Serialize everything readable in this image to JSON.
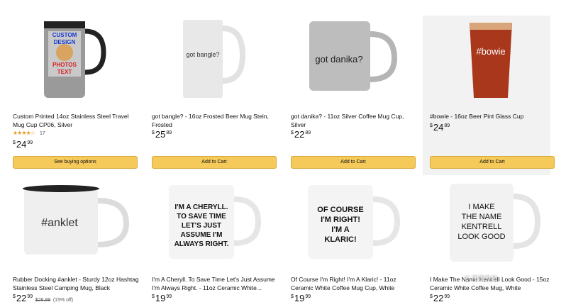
{
  "products": [
    {
      "title": "Custom Printed 14oz Stainless Steel Travel Mug Cup CP06, Silver",
      "price_whole": "24",
      "price_frac": "99",
      "rating_count": "17",
      "button": "See buying options",
      "mug_text": [
        "CUSTOM",
        "DESIGN",
        "PHOTOS",
        "TEXT"
      ]
    },
    {
      "title": "got bangle? - 16oz Frosted Beer Mug Stein, Frosted",
      "price_whole": "25",
      "price_frac": "89",
      "button": "Add to Cart",
      "mug_text": [
        "got bangle?"
      ]
    },
    {
      "title": "got danika? - 11oz Silver Coffee Mug Cup, Silver",
      "price_whole": "22",
      "price_frac": "89",
      "button": "Add to Cart",
      "mug_text": [
        "got danika?"
      ]
    },
    {
      "title": "#bowie - 16oz Beer Pint Glass Cup",
      "price_whole": "24",
      "price_frac": "89",
      "button": "Add to Cart",
      "mug_text": [
        "#bowie"
      ]
    },
    {
      "title": "Rubber Docking #anklet - Sturdy 12oz Hashtag Stainless Steel Camping Mug, Black",
      "price_whole": "22",
      "price_frac": "99",
      "old_price": "$26.99",
      "discount": "(15% off)",
      "mug_text": [
        "#anklet"
      ]
    },
    {
      "title": "I'm A Cheryll. To Save Time Let's Just Assume I'm Always Right. - 11oz Ceramic White...",
      "price_whole": "19",
      "price_frac": "99",
      "mug_text": [
        "I'M A CHERYLL.",
        "TO SAVE TIME",
        "LET'S JUST",
        "ASSUME I'M",
        "ALWAYS RIGHT."
      ]
    },
    {
      "title": "Of Course I'm Right! I'm A Klaric! - 11oz Ceramic White Coffee Mug Cup, White",
      "price_whole": "19",
      "price_frac": "99",
      "mug_text": [
        "OF COURSE",
        "I'M RIGHT!",
        "I'M A",
        "KLARIC!"
      ]
    },
    {
      "title": "I Make The Name Kentrell Look Good - 15oz Ceramic White Coffee Mug, White",
      "price_whole": "22",
      "price_frac": "99",
      "mug_text": [
        "I MAKE",
        "THE NAME",
        "KENTRELL",
        "LOOK GOOD"
      ]
    }
  ],
  "currency": "$",
  "stars": "★★★★☆",
  "watermark": "⊙ 叩海外拍"
}
